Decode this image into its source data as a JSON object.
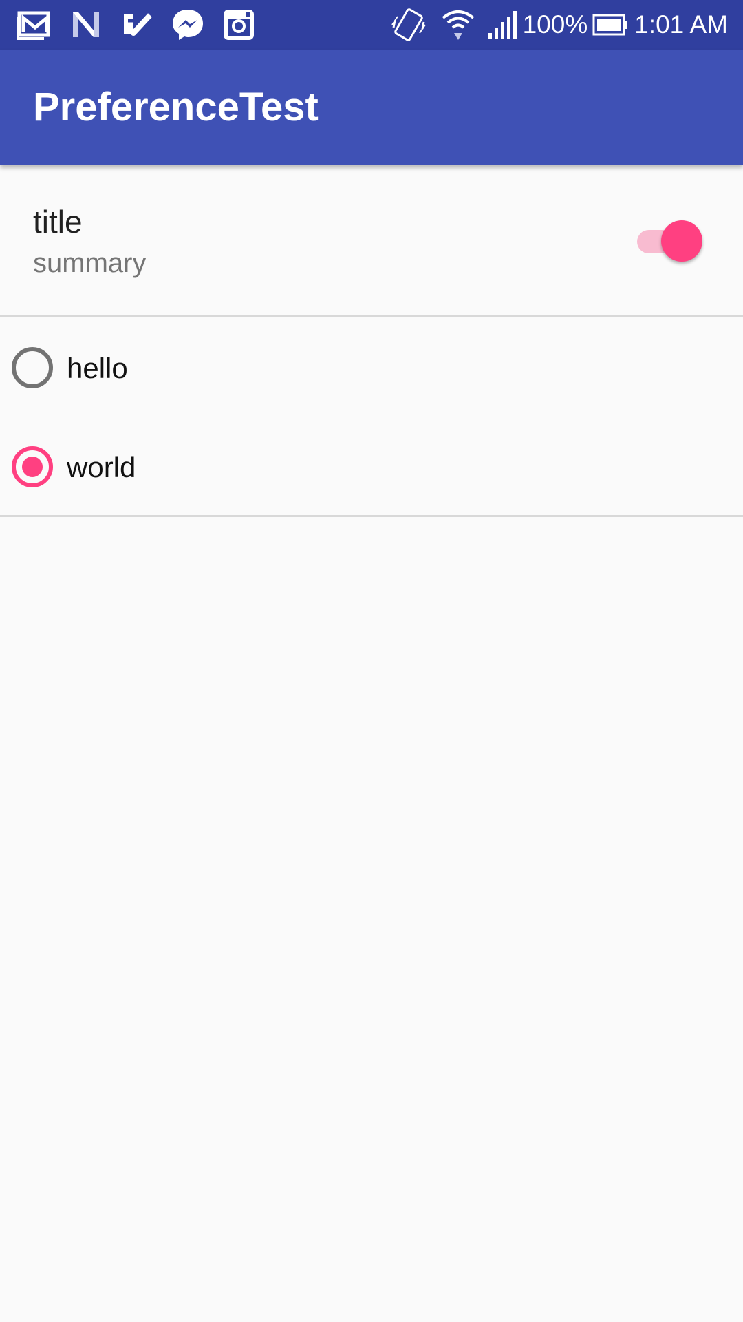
{
  "status_bar": {
    "notification_icons": [
      "gmail-icon",
      "news-icon",
      "tasks-icon",
      "messenger-icon",
      "instagram-icon"
    ],
    "system_icons": [
      "vibrate-icon",
      "wifi-icon",
      "signal-icon",
      "battery-icon"
    ],
    "battery_percent": "100%",
    "time": "1:01 AM"
  },
  "app_bar": {
    "title": "PreferenceTest"
  },
  "switch_preference": {
    "title": "title",
    "summary": "summary",
    "checked": true
  },
  "radio_group": {
    "options": [
      {
        "label": "hello",
        "selected": false
      },
      {
        "label": "world",
        "selected": true
      }
    ]
  },
  "colors": {
    "status_bar": "#303f9f",
    "primary": "#3f51b5",
    "accent": "#ff4081",
    "background": "#fafafa"
  }
}
